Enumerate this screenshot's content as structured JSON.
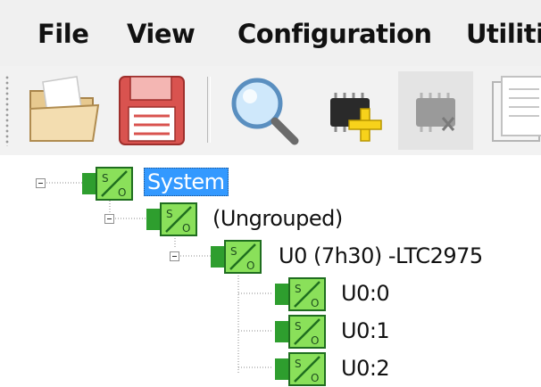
{
  "menu": {
    "file": "File",
    "view": "View",
    "configuration": "Configuration",
    "utilities": "Utilities"
  },
  "toolbar": {
    "icons": [
      "open-folder-icon",
      "save-floppy-icon",
      "search-magnifier-icon",
      "add-device-icon",
      "remove-device-icon",
      "document-icon"
    ]
  },
  "tree": {
    "system": "System",
    "group": "(Ungrouped)",
    "device": "U0 (7h30) -LTC2975",
    "channels": [
      "U0:0",
      "U0:1",
      "U0:2"
    ]
  },
  "colors": {
    "selection": "#3399ff",
    "node_green": "#2e9e2e",
    "node_green_light": "#8ae05a"
  }
}
